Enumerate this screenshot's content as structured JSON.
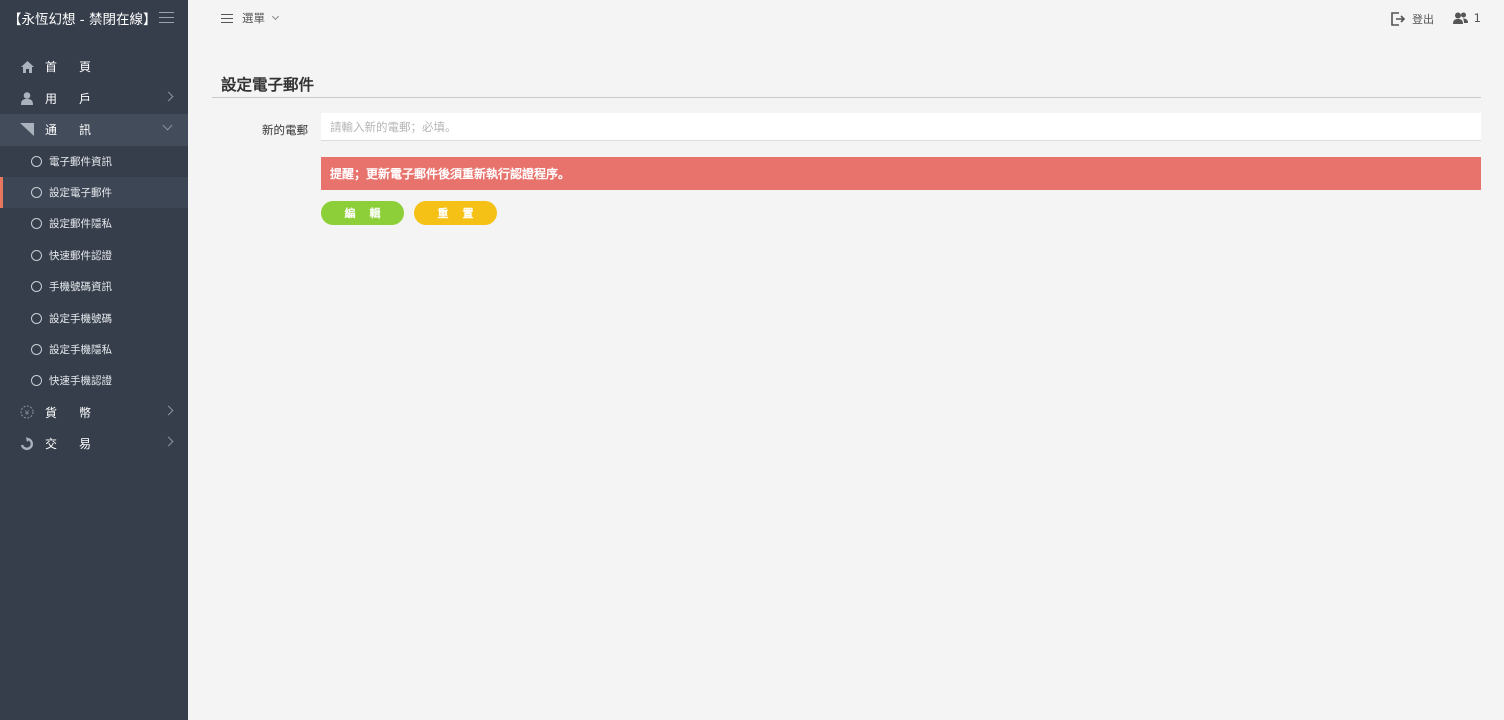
{
  "brand": {
    "title": "【永恆幻想 - 禁閉在線】"
  },
  "sidebar": {
    "items": [
      {
        "label": "首頁",
        "icon": "home-icon"
      },
      {
        "label": "用戶",
        "icon": "user-icon"
      },
      {
        "label": "通訊",
        "icon": "signal-icon"
      },
      {
        "label": "貨幣",
        "icon": "coin-icon"
      },
      {
        "label": "交易",
        "icon": "trade-icon"
      }
    ],
    "sub_items": [
      {
        "label": "電子郵件資訊"
      },
      {
        "label": "設定電子郵件"
      },
      {
        "label": "設定郵件隱私"
      },
      {
        "label": "快速郵件認證"
      },
      {
        "label": "手機號碼資訊"
      },
      {
        "label": "設定手機號碼"
      },
      {
        "label": "設定手機隱私"
      },
      {
        "label": "快速手機認證"
      }
    ]
  },
  "topbar": {
    "menu_label": "選單",
    "logout_label": "登出",
    "user_count": "1"
  },
  "main": {
    "title": "設定電子郵件",
    "field_label": "新的電郵",
    "email_placeholder": "請輸入新的電郵；必填。",
    "email_value": "",
    "alert_text": "提醒；更新電子郵件後須重新執行認證程序。",
    "edit_label": "編輯",
    "reset_label": "重置"
  },
  "colors": {
    "sidebar_bg": "#363e4b",
    "alert_bg": "#e8736d",
    "edit_button": "#8ccf38",
    "reset_button": "#f5c116",
    "active_marker": "#e9765f"
  }
}
